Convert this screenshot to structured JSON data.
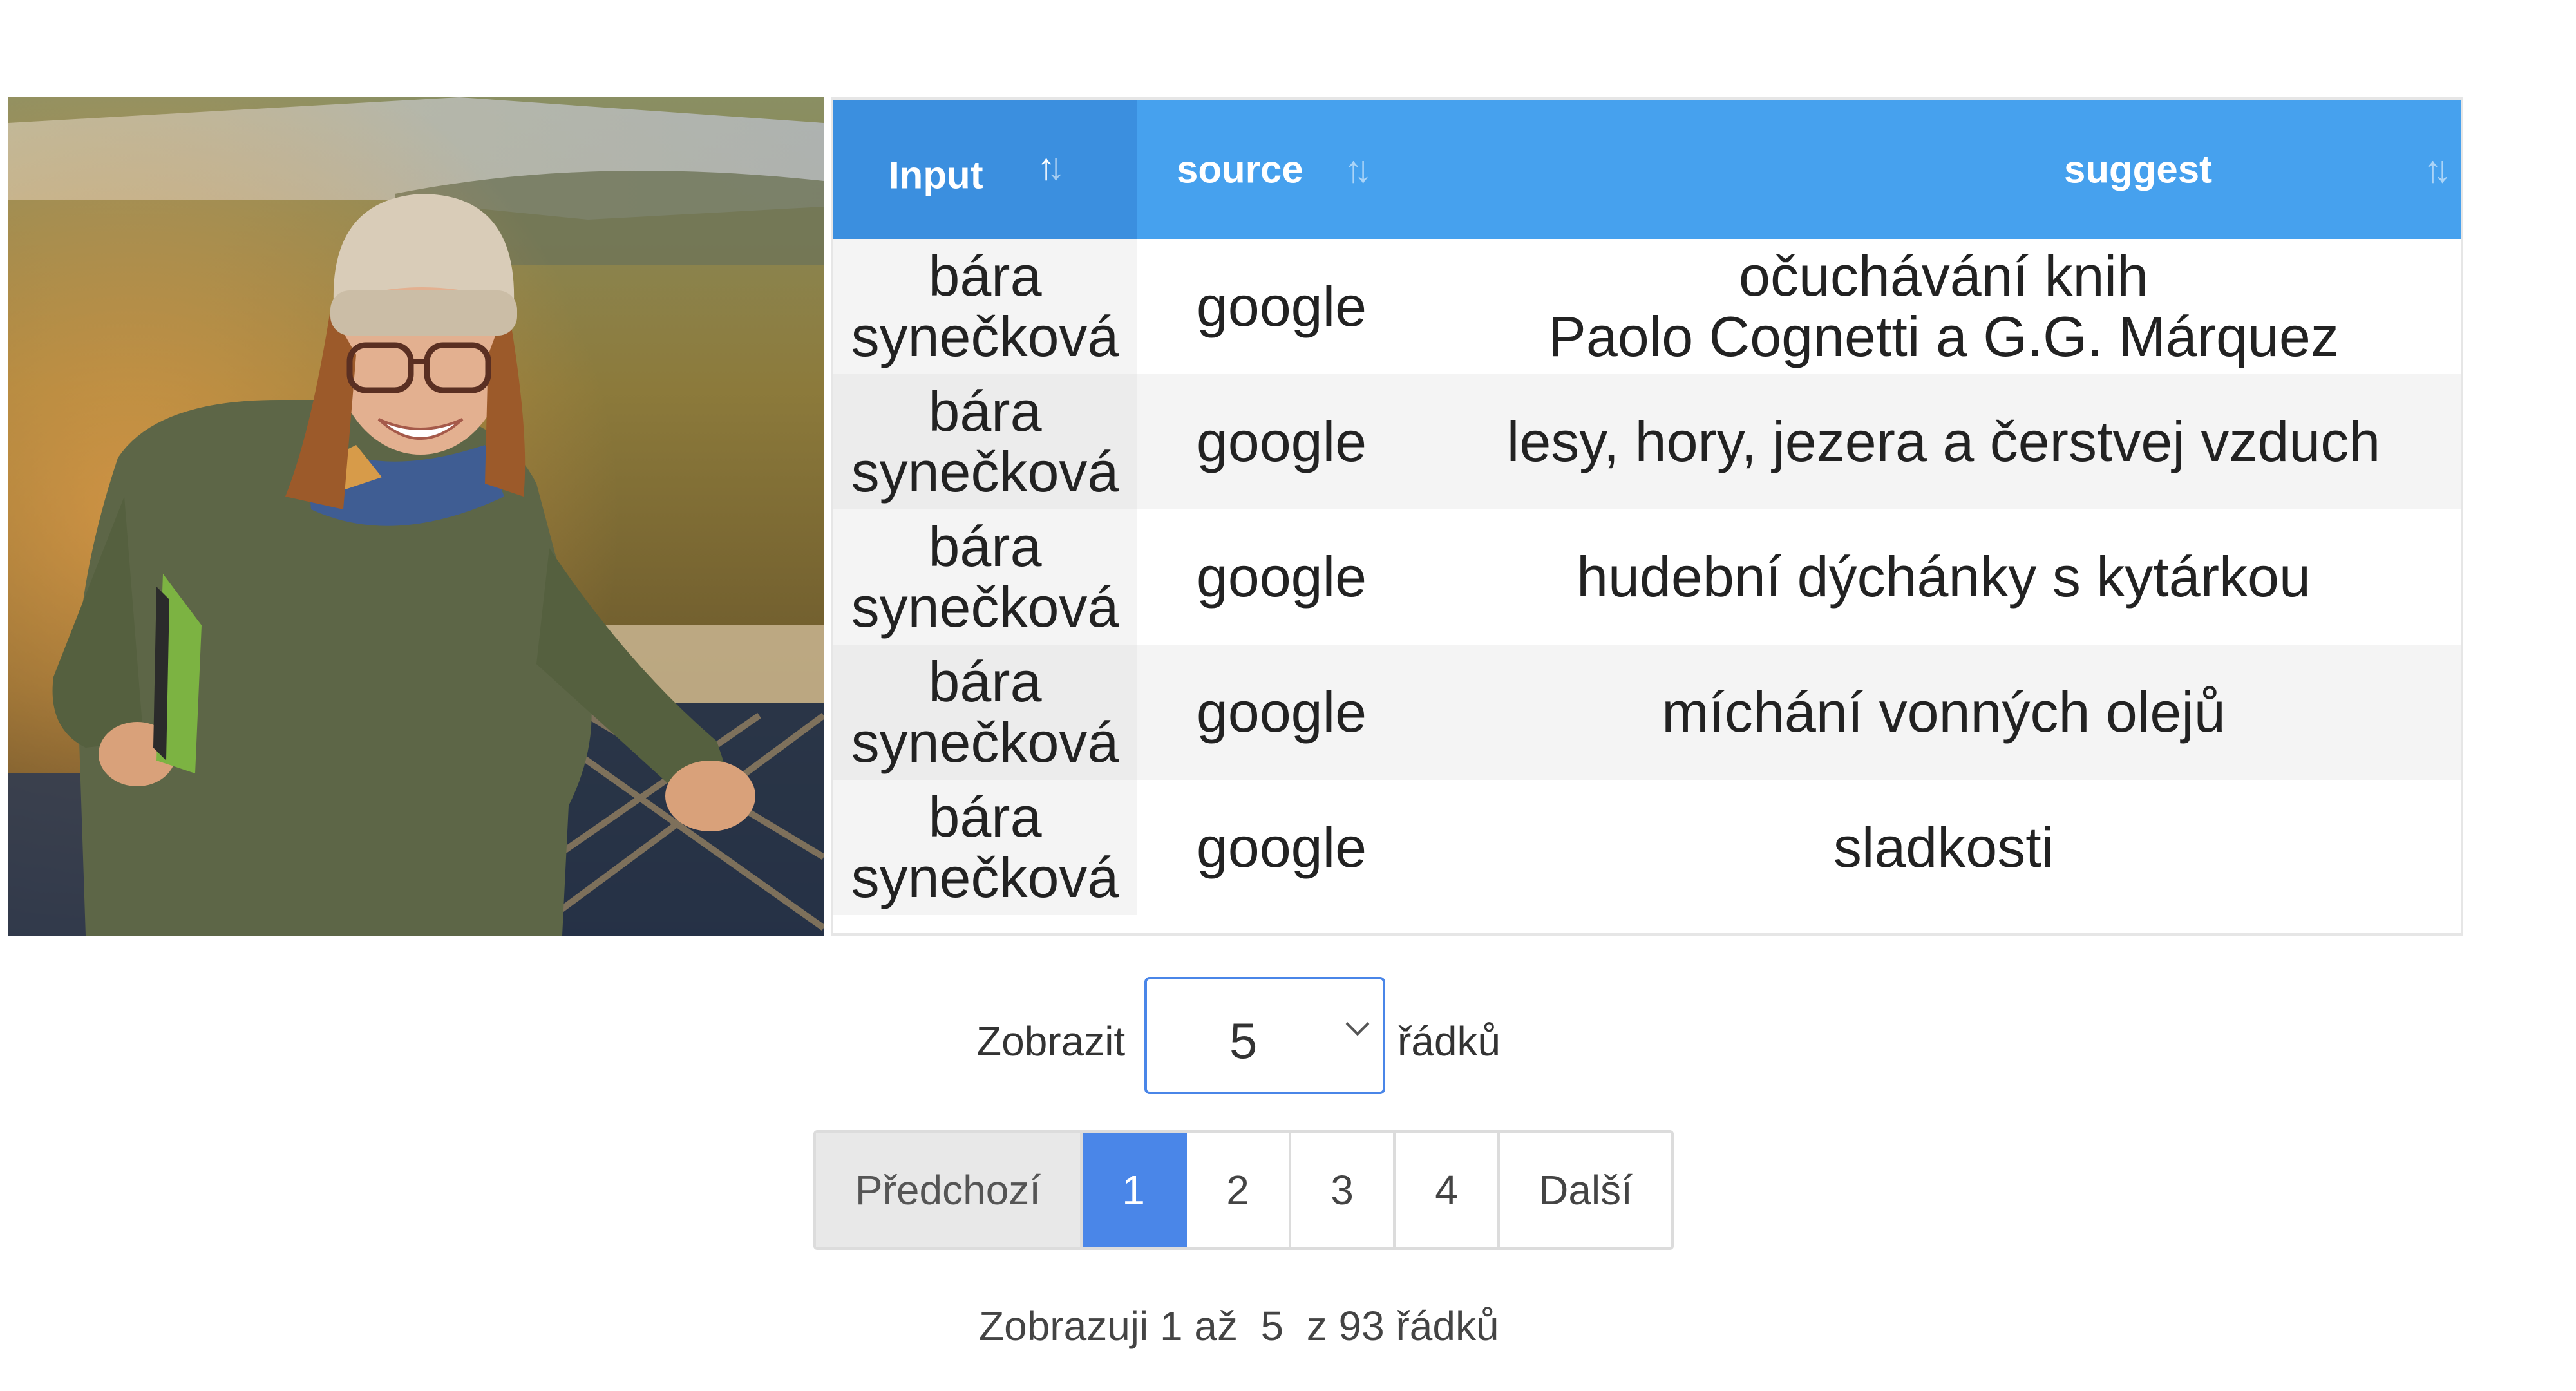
{
  "table": {
    "columns": [
      {
        "label": "Input"
      },
      {
        "label": "source"
      },
      {
        "label": "suggest"
      }
    ],
    "sort_glyph": "↑↓",
    "rows": [
      {
        "input": [
          "bára",
          "synečková"
        ],
        "source": "google",
        "suggest": [
          "očuchávání knih",
          "Paolo Cognetti a G.G. Márquez"
        ]
      },
      {
        "input": [
          "bára",
          "synečková"
        ],
        "source": "google",
        "suggest": [
          "lesy, hory, jezera a čerstvej vzduch"
        ]
      },
      {
        "input": [
          "bára",
          "synečková"
        ],
        "source": "google",
        "suggest": [
          "hudební dýchánky s kytárkou"
        ]
      },
      {
        "input": [
          "bára",
          "synečková"
        ],
        "source": "google",
        "suggest": [
          "míchání vonných olejů"
        ]
      },
      {
        "input": [
          "bára",
          "synečková"
        ],
        "source": "google",
        "suggest": [
          "sladkosti"
        ]
      }
    ]
  },
  "length_control": {
    "prefix": "Zobrazit",
    "selected": "5",
    "suffix": "řádků"
  },
  "pagination": {
    "previous": "Předchozí",
    "pages": [
      "1",
      "2",
      "3",
      "4"
    ],
    "active_page": "1",
    "next": "Další"
  },
  "info": "Zobrazuji 1 až  5  z 93 řádků",
  "colors": {
    "header": "#46a1ee",
    "header_sorted": "#3b8fdf",
    "accent": "#4a86e8"
  },
  "icons": {
    "sort": "sort-arrows-icon",
    "dropdown": "chevron-down-icon"
  }
}
